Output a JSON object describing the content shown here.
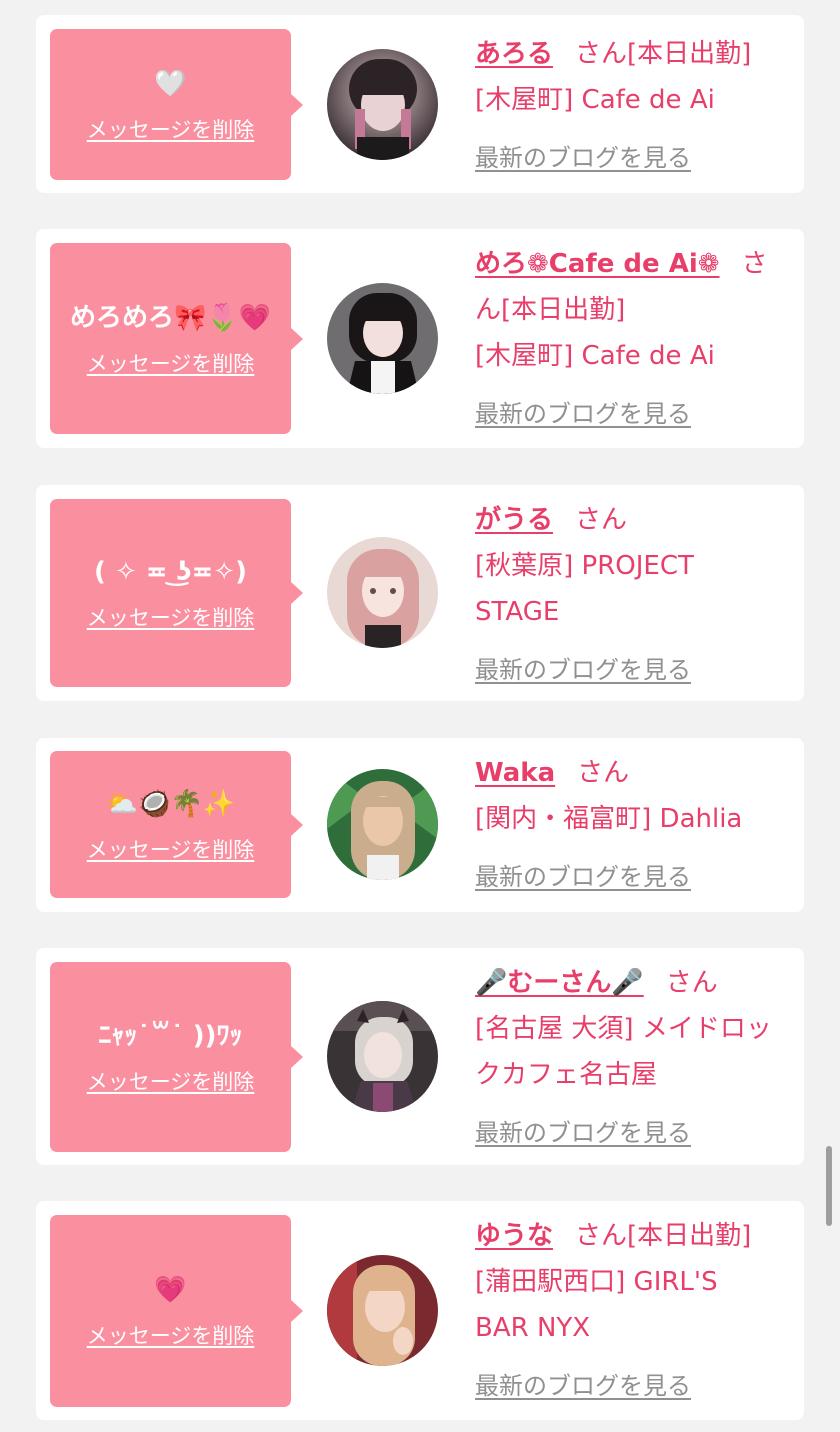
{
  "colors": {
    "page_bg": "#f2f2f2",
    "card_bg": "#ffffff",
    "bubble_bg": "#fa8fa0",
    "accent_text": "#e83e6a",
    "link_gray": "#909090"
  },
  "cards": [
    {
      "message": "🤍",
      "delete_label": "メッセージを削除",
      "name": "あろる",
      "honorific": "さん",
      "status": "[本日出勤]",
      "shop": "[木屋町] Cafe de Ai",
      "blog_label": "最新のブログを見る"
    },
    {
      "message": "めろめろ🎀🌷💗",
      "delete_label": "メッセージを削除",
      "name": "めろ❁Cafe de Ai❁",
      "honorific": "さん",
      "status": "[本日出勤]",
      "shop": "[木屋町] Cafe de Ai",
      "blog_label": "最新のブログを見る"
    },
    {
      "message": "( ✧ ≖ ͜ʖ≖✧)",
      "delete_label": "メッセージを削除",
      "name": "がうる",
      "honorific": "さん",
      "status": "",
      "shop": "[秋葉原] PROJECT STAGE",
      "blog_label": "最新のブログを見る"
    },
    {
      "message": "⛅🥥🌴✨",
      "delete_label": "メッセージを削除",
      "name": "Waka",
      "honorific": "さん",
      "status": "",
      "shop": "[関内・福富町] Dahlia",
      "blog_label": "最新のブログを見る"
    },
    {
      "message": "ﾆｬｯ˙꒳˙ ))ﾜｯ",
      "delete_label": "メッセージを削除",
      "name": "🎤むーさん🎤",
      "honorific": "さん",
      "status": "",
      "shop": "[名古屋 大須] メイドロックカフェ名古屋",
      "blog_label": "最新のブログを見る"
    },
    {
      "message": "💗",
      "delete_label": "メッセージを削除",
      "name": "ゆうな",
      "honorific": "さん",
      "status": "[本日出勤]",
      "shop": "[蒲田駅西口] GIRL'S BAR NYX",
      "blog_label": "最新のブログを見る"
    }
  ]
}
